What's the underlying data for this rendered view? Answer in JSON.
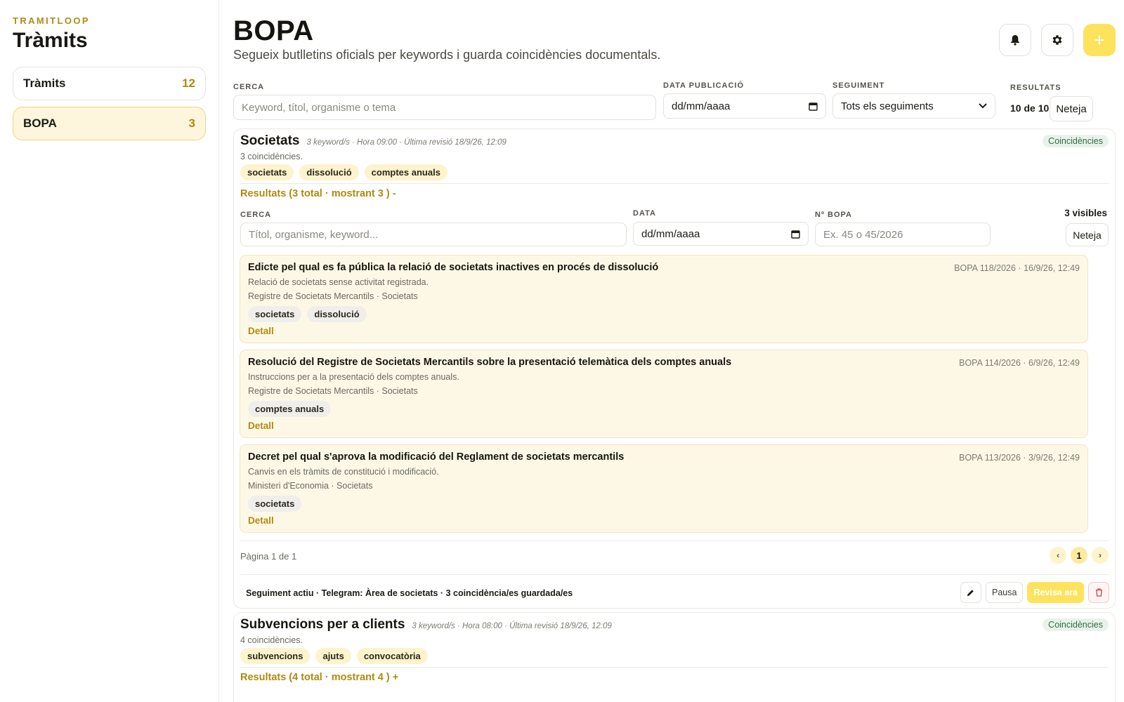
{
  "sidebar": {
    "brand": "TRAMITLOOP",
    "title": "Tràmits",
    "items": [
      {
        "label": "Tràmits",
        "count": "12"
      },
      {
        "label": "BOPA",
        "count": "3"
      }
    ]
  },
  "header": {
    "title": "BOPA",
    "subtitle": "Segueix butlletins oficials per keywords i guarda coincidències documentals.",
    "add_label": "+"
  },
  "filters": {
    "search_label": "CERCA",
    "search_placeholder": "Keyword, títol, organisme o tema",
    "date_label": "DATA PUBLICACIÓ",
    "date_value": "dd/mm/aaaa",
    "follow_label": "SEGUIMENT",
    "follow_value": "Tots els seguiments",
    "results_label": "RESULTATS",
    "results_value": "10 de 10",
    "clear_label": "Neteja"
  },
  "watches": [
    {
      "name": "Societats",
      "meta": "3 keyword/s · Hora 09:00 · Última revisió 18/9/26, 12:09",
      "badge": "Coincidències",
      "coincidences": "3 coincidències.",
      "keywords": [
        "societats",
        "dissolució",
        "comptes anuals"
      ],
      "results_toggle": "Resultats (3 total · mostrant 3 ) -",
      "inner_filters": {
        "search_label": "CERCA",
        "search_placeholder": "Títol, organisme, keyword...",
        "date_label": "DATA",
        "date_value": "dd/mm/aaaa",
        "num_label": "Nº BOPA",
        "num_placeholder": "Ex. 45 o 45/2026",
        "visible": "3 visibles",
        "clear_label": "Neteja"
      },
      "results": [
        {
          "title": "Edicte pel qual es fa pública la relació de societats inactives en procés de dissolució",
          "ref": "BOPA 118/2026 · 16/9/26, 12:49",
          "description": "Relació de societats sense activitat registrada.",
          "org": "Registre de Societats Mercantils · Societats",
          "tags": [
            "societats",
            "dissolució"
          ],
          "detail": "Detall"
        },
        {
          "title": "Resolució del Registre de Societats Mercantils sobre la presentació telemàtica dels comptes anuals",
          "ref": "BOPA 114/2026 · 6/9/26, 12:49",
          "description": "Instruccions per a la presentació dels comptes anuals.",
          "org": "Registre de Societats Mercantils · Societats",
          "tags": [
            "comptes anuals"
          ],
          "detail": "Detall"
        },
        {
          "title": "Decret pel qual s'aprova la modificació del Reglament de societats mercantils",
          "ref": "BOPA 113/2026 · 3/9/26, 12:49",
          "description": "Canvis en els tràmits de constitució i modificació.",
          "org": "Ministeri d'Economia · Societats",
          "tags": [
            "societats"
          ],
          "detail": "Detall"
        }
      ],
      "pagination": {
        "text": "Pàgina 1 de 1",
        "current": "1",
        "prev": "‹",
        "next": "›"
      },
      "status": "Seguiment actiu · Telegram: Àrea de societats · 3 coincidència/es guardada/es",
      "actions": {
        "pause": "Pausa",
        "review": "Revisa ara"
      }
    },
    {
      "name": "Subvencions per a clients",
      "meta": "3 keyword/s · Hora 08:00 · Última revisió 18/9/26, 12:09",
      "badge": "Coincidències",
      "coincidences": "4 coincidències.",
      "keywords": [
        "subvencions",
        "ajuts",
        "convocatòria"
      ],
      "results_toggle": "Resultats (4 total · mostrant 4 ) +"
    }
  ],
  "colors": {
    "accent": "#b08a10",
    "primary_button": "#fde25c",
    "result_bg": "#fdf8e6",
    "chip_bg": "#fdf3cd",
    "badge_bg": "#e9f2ea"
  }
}
